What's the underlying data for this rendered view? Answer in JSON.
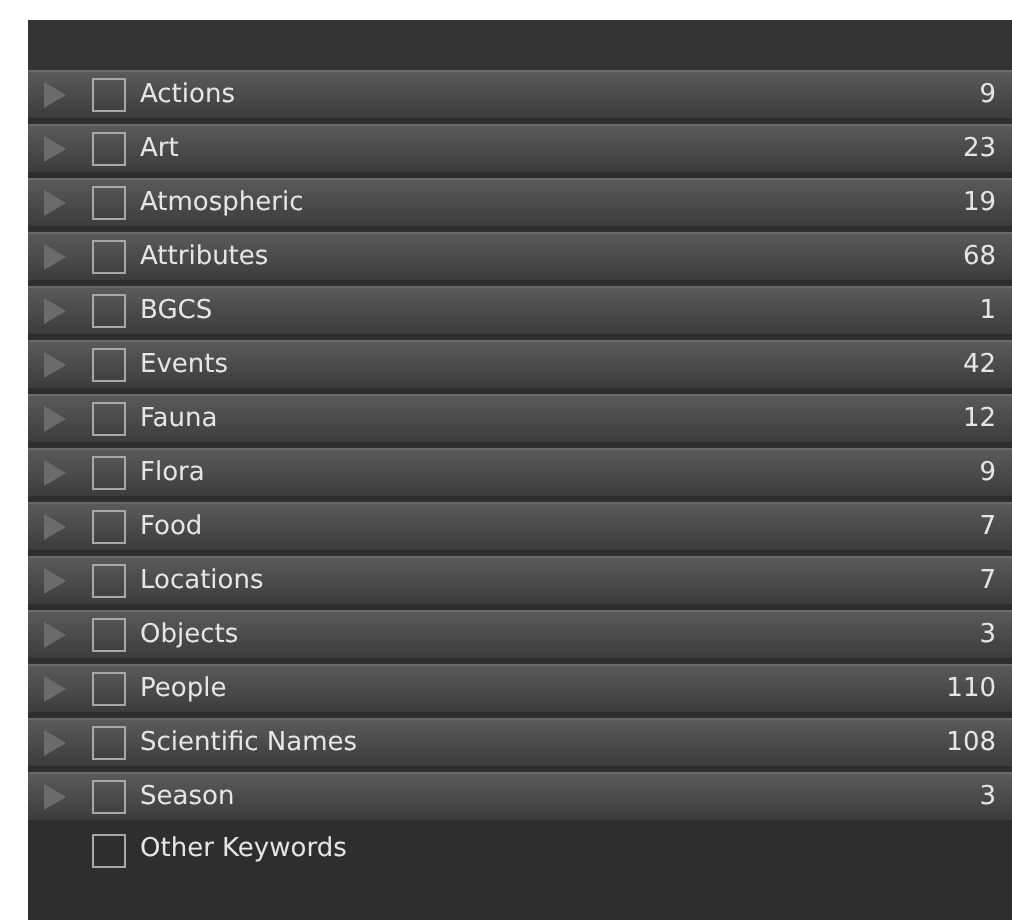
{
  "categories": [
    {
      "kind": "group",
      "label": "Actions",
      "count": "9",
      "checked": false,
      "expanded": false
    },
    {
      "kind": "group",
      "label": "Art",
      "count": "23",
      "checked": false,
      "expanded": false
    },
    {
      "kind": "group",
      "label": "Atmospheric",
      "count": "19",
      "checked": false,
      "expanded": false
    },
    {
      "kind": "group",
      "label": "Attributes",
      "count": "68",
      "checked": false,
      "expanded": false
    },
    {
      "kind": "group",
      "label": "BGCS",
      "count": "1",
      "checked": false,
      "expanded": false
    },
    {
      "kind": "group",
      "label": "Events",
      "count": "42",
      "checked": false,
      "expanded": false
    },
    {
      "kind": "group",
      "label": "Fauna",
      "count": "12",
      "checked": false,
      "expanded": false
    },
    {
      "kind": "group",
      "label": "Flora",
      "count": "9",
      "checked": false,
      "expanded": false
    },
    {
      "kind": "group",
      "label": "Food",
      "count": "7",
      "checked": false,
      "expanded": false
    },
    {
      "kind": "group",
      "label": "Locations",
      "count": "7",
      "checked": false,
      "expanded": false
    },
    {
      "kind": "group",
      "label": "Objects",
      "count": "3",
      "checked": false,
      "expanded": false
    },
    {
      "kind": "group",
      "label": "People",
      "count": "110",
      "checked": false,
      "expanded": false
    },
    {
      "kind": "group",
      "label": "Scientific Names",
      "count": "108",
      "checked": false,
      "expanded": false
    },
    {
      "kind": "group",
      "label": "Season",
      "count": "3",
      "checked": false,
      "expanded": false
    },
    {
      "kind": "plain",
      "label": "Other Keywords",
      "checked": false
    }
  ]
}
